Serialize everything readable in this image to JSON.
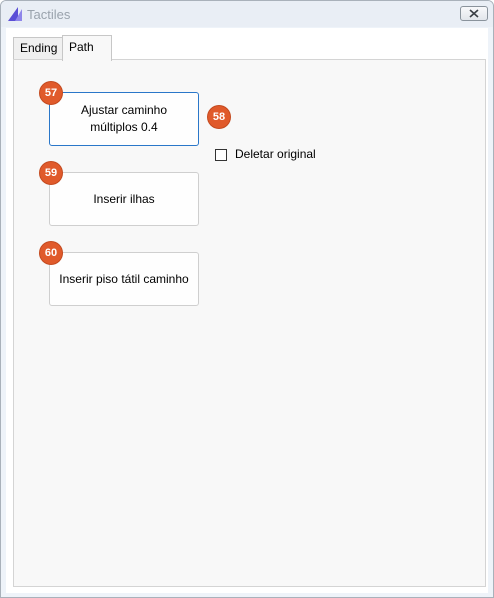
{
  "window": {
    "title": "Tactiles",
    "accent": "#5b4fd6"
  },
  "tabs": [
    {
      "label": "Ending",
      "selected": false
    },
    {
      "label": "Path",
      "selected": true
    }
  ],
  "panel": {
    "adjust_button": {
      "label": "Ajustar caminho\nmúltiplos 0.4",
      "badge": "57"
    },
    "delete_original": {
      "label": "Deletar original",
      "checked": false,
      "badge": "58"
    },
    "insert_islands_button": {
      "label": "Inserir ilhas",
      "badge": "59"
    },
    "insert_tactile_button": {
      "label": "Inserir piso tátil caminho",
      "badge": "60"
    }
  },
  "colors": {
    "badge": "#e05a2b",
    "focus": "#2a77c9"
  },
  "icons": {
    "app": "tactiles-logo-icon",
    "close": "close-icon"
  }
}
